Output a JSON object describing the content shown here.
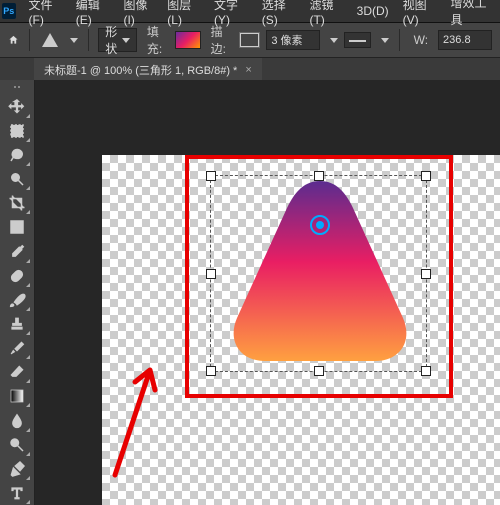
{
  "app_logo": "Ps",
  "menus": [
    "文件(F)",
    "编辑(E)",
    "图像(I)",
    "图层(L)",
    "文字(Y)",
    "选择(S)",
    "滤镜(T)",
    "3D(D)",
    "视图(V)",
    "增效工具"
  ],
  "options": {
    "tool_mode": "形状",
    "fill_label": "填充:",
    "stroke_label": "描边:",
    "stroke_width": "3 像素",
    "width_label": "W:",
    "width_value": "236.8"
  },
  "tab": {
    "title": "未标题-1 @ 100% (三角形 1, RGB/8#) *",
    "close": "×"
  },
  "tools": [
    "move",
    "marquee",
    "lasso",
    "wand",
    "crop",
    "frame",
    "eyedropper",
    "heal",
    "brush",
    "stamp",
    "history",
    "eraser",
    "gradient",
    "blur",
    "dodge",
    "pen",
    "type"
  ]
}
